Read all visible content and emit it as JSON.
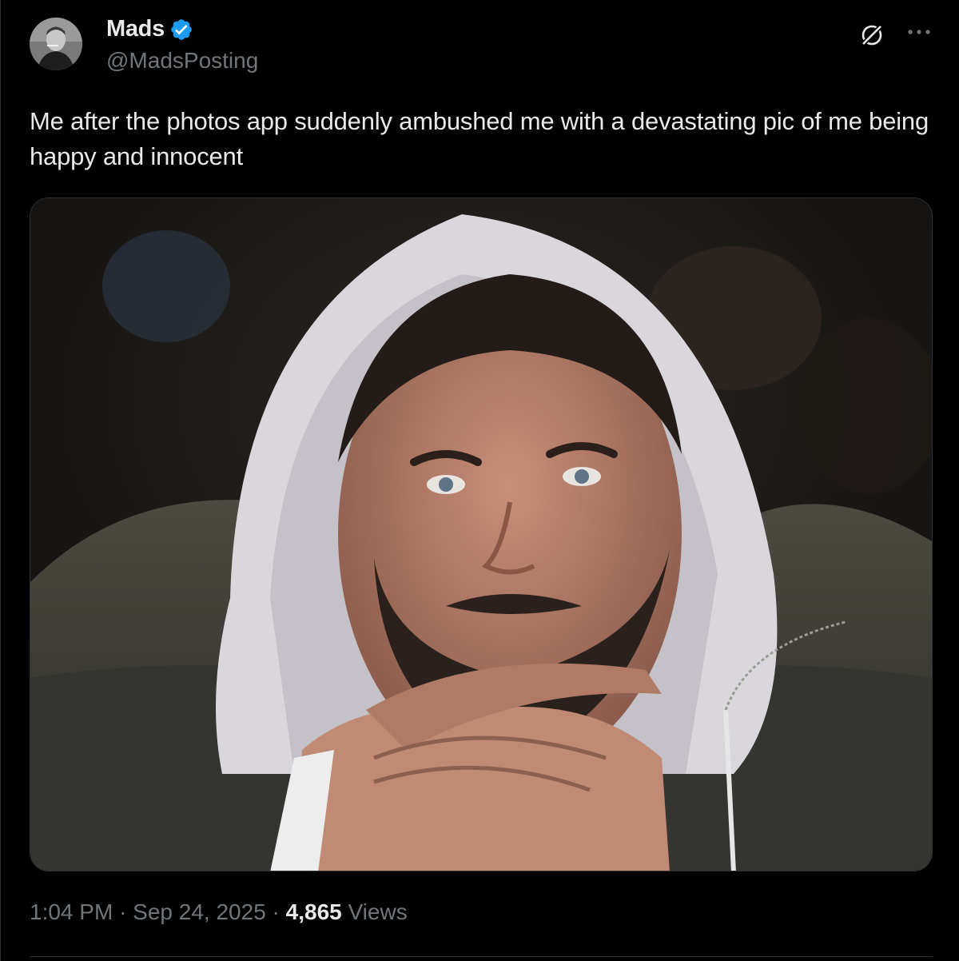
{
  "author": {
    "display_name": "Mads",
    "handle": "@MadsPosting",
    "verified": true
  },
  "tweet": {
    "text": "Me after the photos app suddenly ambushed me with a devastating pic of me being happy and innocent"
  },
  "meta": {
    "time": "1:04 PM",
    "separator": "·",
    "date": "Sep 24, 2025",
    "views_count": "4,865",
    "views_label": "Views"
  },
  "icons": {
    "verified": "verified-badge-icon",
    "grok": "grok-icon",
    "more": "more-options-icon"
  },
  "colors": {
    "background": "#000000",
    "text_primary": "#e7e9ea",
    "text_secondary": "#71767b",
    "verified_blue": "#1d9bf0",
    "border": "#2f3336"
  }
}
